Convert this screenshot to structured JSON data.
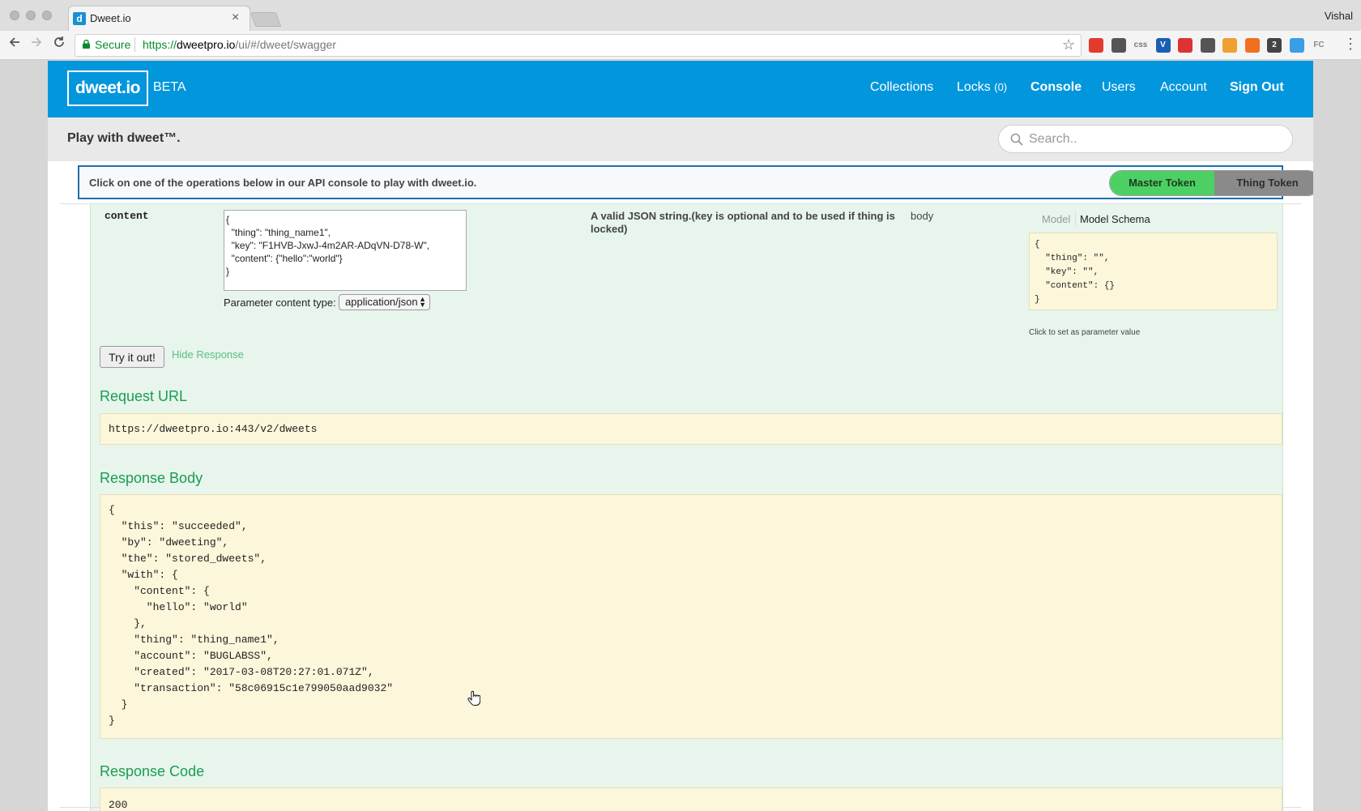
{
  "browser": {
    "tab_title": "Dweet.io",
    "tab_favicon": "d",
    "profile_name": "Vishal",
    "secure_label": "Secure",
    "url_scheme": "https://",
    "url_host": "dweetpro.io",
    "url_path": "/ui/#/dweet/swagger",
    "extensions": [
      "opera-icon",
      "pocket-icon",
      "css-icon",
      "v-icon",
      "scissors-icon",
      "mail-icon",
      "color-icon",
      "orange-icon",
      "counter-icon",
      "shield-icon",
      "fc-icon"
    ],
    "extension_colors": [
      "#e23b2e",
      "#555555",
      "#777777",
      "#1a5fb4",
      "#d33",
      "#555555",
      "#f0a030",
      "#f07020",
      "#444444",
      "#3a9ee4",
      "#8a8a8a"
    ],
    "extension_labels": [
      "",
      "",
      "css",
      "V",
      "",
      "",
      "",
      "",
      "2",
      "",
      "FC"
    ]
  },
  "header": {
    "logo": "dweet.io",
    "beta": "BETA",
    "nav": {
      "collections": "Collections",
      "locks": "Locks",
      "locks_count": "(0)",
      "console": "Console",
      "users": "Users",
      "account": "Account",
      "sign_out": "Sign Out"
    },
    "brand_color": "#0296dc"
  },
  "subheader": {
    "title": "Play with dweet™.",
    "search_placeholder": "Search.."
  },
  "info_bar": {
    "text": "Click on one of the operations below in our API console to play with dweet.io.",
    "master_token": "Master Token",
    "thing_token": "Thing Token"
  },
  "parameter": {
    "name": "content",
    "value": "{\n  \"thing\": \"thing_name1\",\n  \"key\": \"F1HVB-JxwJ-4m2AR-ADqVN-D78-W\",\n  \"content\": {\"hello\":\"world\"}\n}",
    "content_type_label": "Parameter content type:",
    "content_type": "application/json",
    "description": "A valid JSON string.(key is optional and to be used if thing is locked)",
    "param_type": "body",
    "model_tab": "Model",
    "model_schema_tab": "Model Schema",
    "schema": "{\n  \"thing\": \"\",\n  \"key\": \"\",\n  \"content\": {}\n}",
    "schema_hint": "Click to set as parameter value"
  },
  "actions": {
    "try_it_out": "Try it out!",
    "hide_response": "Hide Response"
  },
  "request_url": {
    "title": "Request URL",
    "value": "https://dweetpro.io:443/v2/dweets"
  },
  "response_body": {
    "title": "Response Body",
    "value": "{\n  \"this\": \"succeeded\",\n  \"by\": \"dweeting\",\n  \"the\": \"stored_dweets\",\n  \"with\": {\n    \"content\": {\n      \"hello\": \"world\"\n    },\n    \"thing\": \"thing_name1\",\n    \"account\": \"BUGLABSS\",\n    \"created\": \"2017-03-08T20:27:01.071Z\",\n    \"transaction\": \"58c06915c1e799050aad9032\"\n  }\n}"
  },
  "response_code": {
    "title": "Response Code",
    "value": "200"
  }
}
